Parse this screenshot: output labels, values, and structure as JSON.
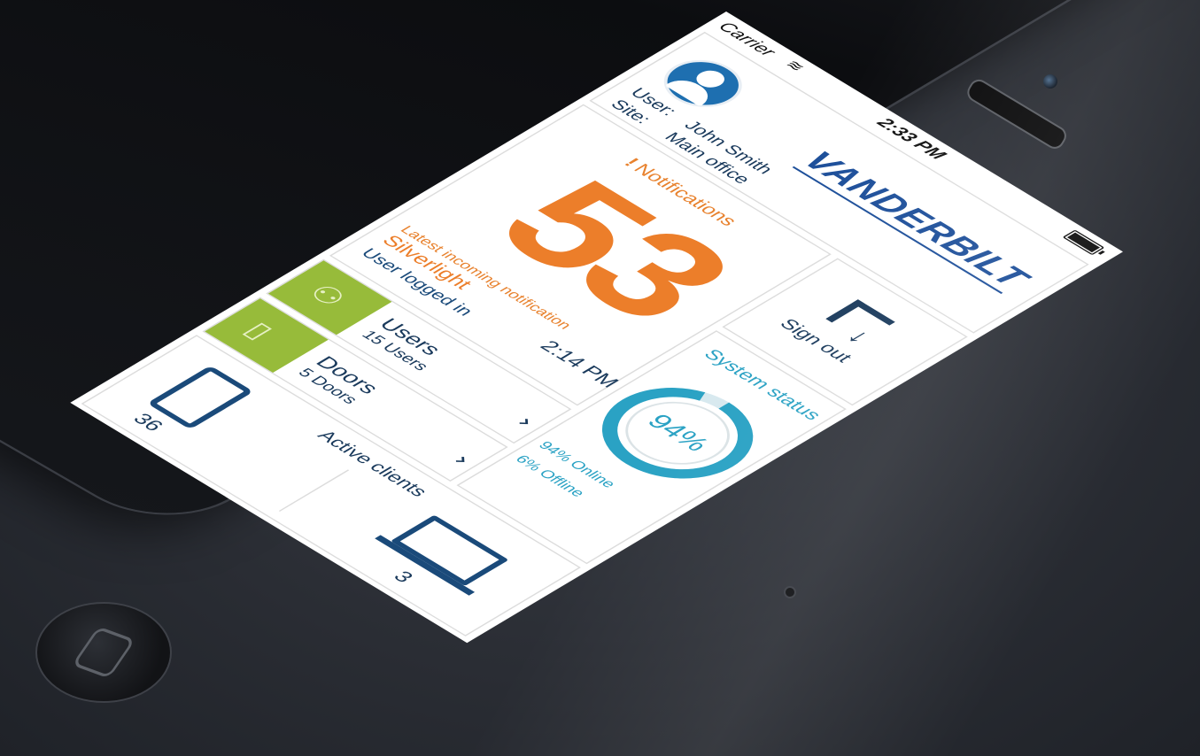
{
  "statusbar": {
    "carrier": "Carrier",
    "time": "2:33 PM"
  },
  "header": {
    "user_label": "User:",
    "user_value": "John Smith",
    "site_label": "Site:",
    "site_value": "Main office",
    "logo": "VANDERBILT"
  },
  "notifications": {
    "title": "Notifications",
    "count": "53",
    "latest_label": "Latest incoming notification",
    "latest_name": "Silverlight",
    "latest_desc": "User logged in",
    "latest_time": "2:14 PM"
  },
  "signout": {
    "label": "Sign out"
  },
  "system_status": {
    "title": "System status",
    "percent": 94,
    "percent_label": "94%",
    "online": "94% Online",
    "offline": "6% Offline"
  },
  "users": {
    "title": "Users",
    "subtitle": "15 Users"
  },
  "doors": {
    "title": "Doors",
    "subtitle": "5 Doors"
  },
  "active_clients": {
    "title": "Active clients",
    "mobile_count": "36",
    "desktop_count": "3"
  },
  "colors": {
    "brand_blue": "#1d4f9a",
    "orange": "#ec7e2a",
    "teal": "#2aa2c4",
    "green": "#97bb3a"
  }
}
